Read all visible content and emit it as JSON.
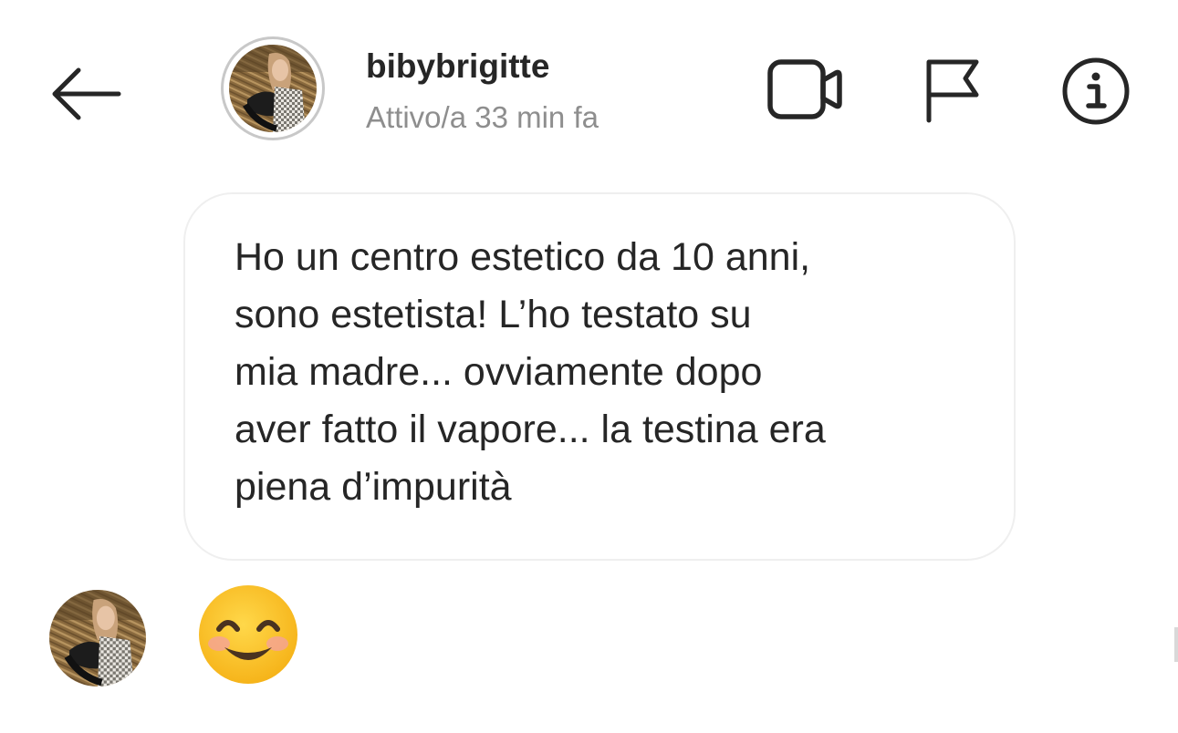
{
  "header": {
    "back_icon": "arrow-left-icon",
    "username": "bibybrigitte",
    "status": "Attivo/a 33 min fa",
    "actions": [
      {
        "id": "video",
        "icon": "video-camera-icon"
      },
      {
        "id": "flag",
        "icon": "flag-icon"
      },
      {
        "id": "info",
        "icon": "info-icon"
      }
    ]
  },
  "conversation": {
    "messages": [
      {
        "type": "text",
        "text": "Ho un centro estetico da 10 anni,\nsono estetista! L’ho testato su\nmia madre... ovviamente dopo\naver fatto il vapore... la testina era\npiena d’impurità"
      },
      {
        "type": "emoji",
        "emoji": "smiling-face-with-smiling-eyes"
      }
    ]
  },
  "colors": {
    "text": "#262626",
    "secondary_text": "#8e8e8e",
    "bubble_border": "#efefef",
    "avatar_ring": "#c8c8c8",
    "emoji_face": "#fcc21b"
  }
}
